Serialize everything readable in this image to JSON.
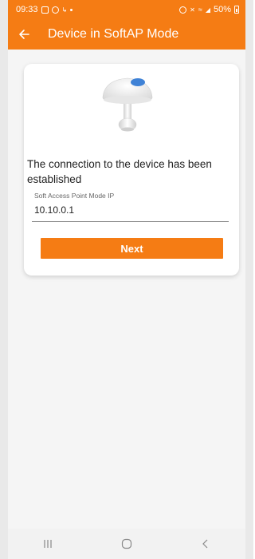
{
  "status_bar": {
    "time": "09:33",
    "battery": "50%"
  },
  "app_bar": {
    "title": "Device in SoftAP Mode",
    "back_icon": "arrow-left-icon"
  },
  "card": {
    "device_image": "device-image",
    "message": "The connection to the device has been established",
    "ip_field": {
      "label": "Soft Access Point Mode IP",
      "value": "10.10.0.1"
    },
    "next_label": "Next"
  },
  "nav_bar": {
    "icons": [
      "recent-apps-icon",
      "home-icon",
      "back-icon"
    ]
  },
  "colors": {
    "accent": "#f57c14",
    "device_button": "#3f82d6"
  }
}
